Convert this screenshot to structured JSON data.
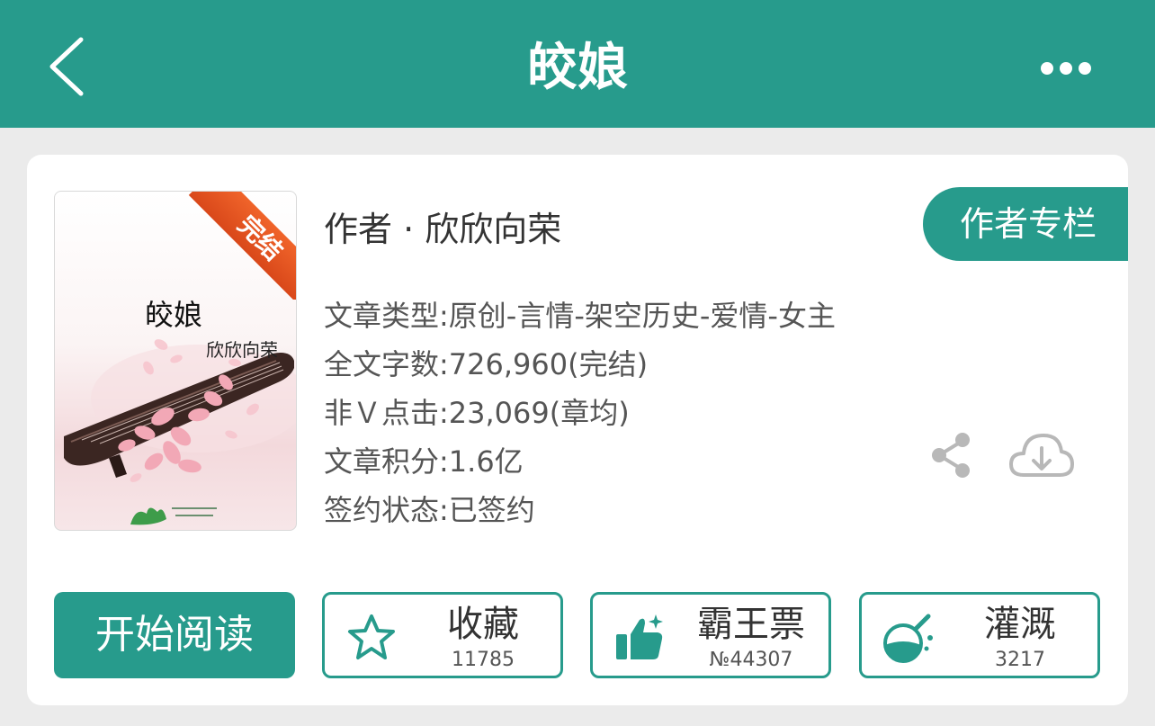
{
  "header": {
    "title": "皎娘",
    "back_icon": "chevron-left-icon",
    "more_icon": "more-dots-icon",
    "background_color": "#279b8c"
  },
  "book": {
    "cover": {
      "badge": "完结",
      "title": "皎娘",
      "author": "欣欣向荣"
    },
    "author_line": "作者 · 欣欣向荣",
    "author_column_button": "作者专栏",
    "meta": {
      "category": "文章类型:原创-言情-架空历史-爱情-女主",
      "word_count": "全文字数:726,960(完结)",
      "clicks": "非Ｖ点击:23,069(章均)",
      "score": "文章积分:1.6亿",
      "sign_status": "签约状态:已签约"
    },
    "share_icon": "share-icon",
    "download_icon": "cloud-download-icon"
  },
  "actions": {
    "read_label": "开始阅读",
    "favorite": {
      "label": "收藏",
      "count": "11785",
      "icon": "star-icon"
    },
    "vote": {
      "label": "霸王票",
      "count": "№44307",
      "icon": "thumbs-up-icon"
    },
    "nutrient": {
      "label": "灌溉",
      "count": "3217",
      "icon": "flask-icon"
    }
  },
  "colors": {
    "accent": "#279b8c",
    "badge": "#e8561f"
  }
}
